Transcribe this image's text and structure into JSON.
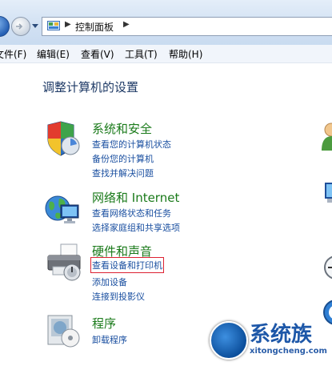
{
  "address_bar": {
    "breadcrumb": "控制面板"
  },
  "menu_bar": {
    "items": [
      "文件(F)",
      "编辑(E)",
      "查看(V)",
      "工具(T)",
      "帮助(H)"
    ]
  },
  "page": {
    "heading": "调整计算机的设置"
  },
  "categories": [
    {
      "title": "系统和安全",
      "icon": "shield-icon",
      "links": [
        "查看您的计算机状态",
        "备份您的计算机",
        "查找并解决问题"
      ]
    },
    {
      "title": "网络和 Internet",
      "icon": "network-globe-icon",
      "links": [
        "查看网络状态和任务",
        "选择家庭组和共享选项"
      ]
    },
    {
      "title": "硬件和声音",
      "icon": "printer-icon",
      "links": [
        "查看设备和打印机",
        "添加设备",
        "连接到投影仪"
      ]
    },
    {
      "title": "程序",
      "icon": "programs-icon",
      "links": [
        "卸载程序"
      ]
    }
  ],
  "watermark": {
    "text": "系统族",
    "url": "xitongcheng.com"
  },
  "colors": {
    "category_title": "#1a7a1a",
    "link": "#1a4fa0",
    "highlight_box": "#dd2233"
  }
}
